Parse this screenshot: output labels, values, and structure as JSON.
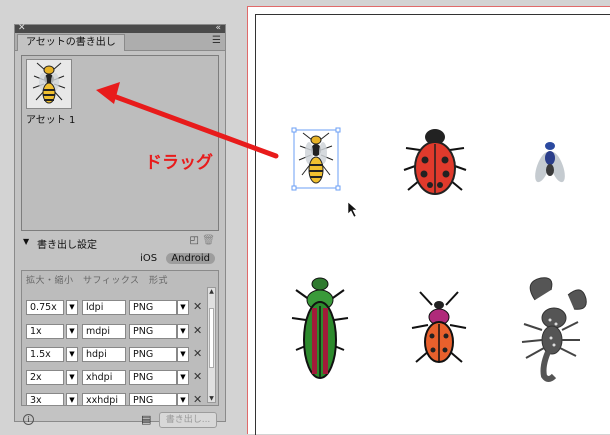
{
  "panel": {
    "title": "アセットの書き出し",
    "close_glyph": "✕",
    "collapse_glyph": "«",
    "menu_glyph": "☰",
    "asset": {
      "label": "アセット 1"
    },
    "section": {
      "title": "書き出し設定"
    },
    "platform": {
      "ios": "iOS",
      "android": "Android"
    },
    "table_header": "拡大・縮小　サフィックス　形式",
    "rows": [
      {
        "scale": "0.75x",
        "suffix": "ldpi",
        "format": "PNG"
      },
      {
        "scale": "1x",
        "suffix": "mdpi",
        "format": "PNG"
      },
      {
        "scale": "1.5x",
        "suffix": "hdpi",
        "format": "PNG"
      },
      {
        "scale": "2x",
        "suffix": "xhdpi",
        "format": "PNG"
      },
      {
        "scale": "3x",
        "suffix": "xxhdpi",
        "format": "PNG"
      }
    ],
    "footer": {
      "info": "i",
      "export_label": "書き出し..."
    }
  },
  "annotation": {
    "drag_label": "ドラッグ",
    "arrow_color": "#e81b1b"
  },
  "canvas": {
    "insects": [
      "wasp-icon",
      "ladybug-icon",
      "fly-icon",
      "jewel-beetle-icon",
      "spotted-beetle-icon",
      "scorpion-icon"
    ]
  }
}
